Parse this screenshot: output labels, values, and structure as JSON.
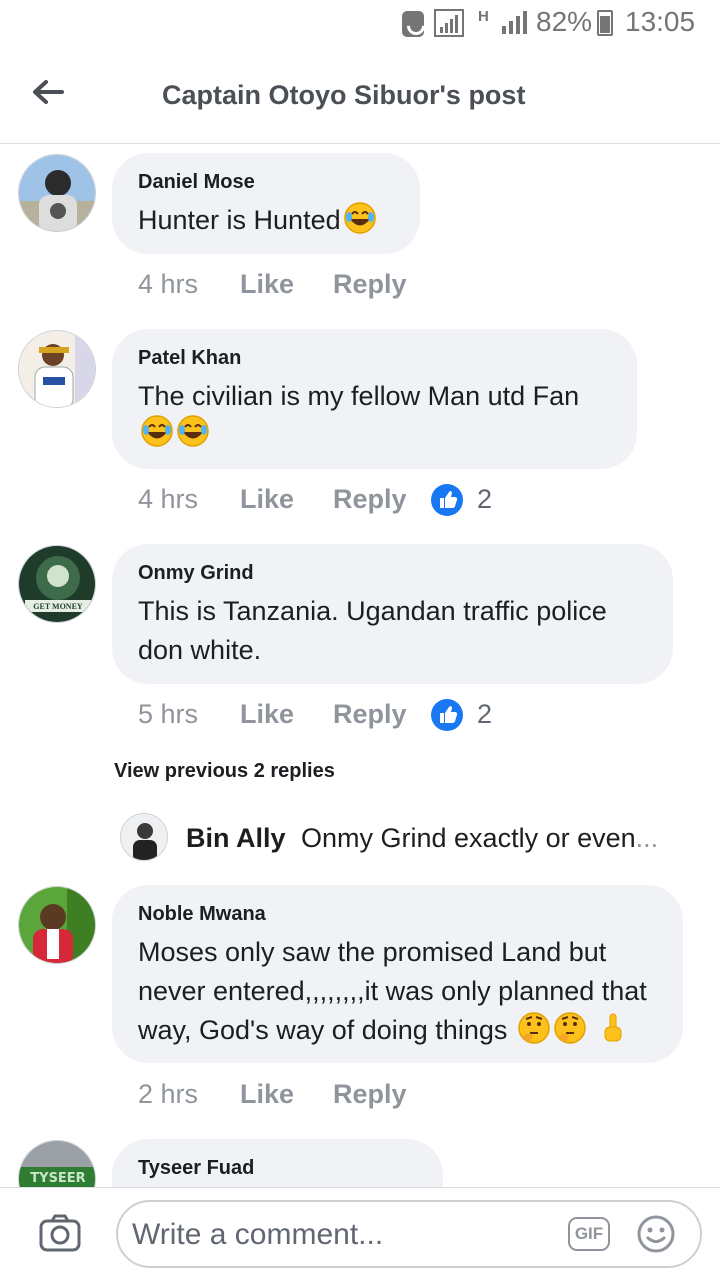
{
  "status_bar": {
    "signal_label": "H",
    "battery": "82%",
    "time": "13:05",
    "icons": [
      "phone-icon",
      "signal-icon",
      "battery-icon"
    ]
  },
  "header": {
    "title": "Captain Otoyo Sibuor's post",
    "back_icon": "arrow-left-icon"
  },
  "comments": [
    {
      "name": "Daniel Mose",
      "text": "Hunter is Hunted",
      "emoji": [
        "tears-of-joy-emoji"
      ],
      "time": "4 hrs",
      "like_label": "Like",
      "reply_label": "Reply"
    },
    {
      "name": "Patel Khan",
      "text_line1": "The civilian is my fellow Man utd Fan",
      "emoji": [
        "tears-of-joy-emoji",
        "tears-of-joy-emoji"
      ],
      "time": "4 hrs",
      "like_label": "Like",
      "reply_label": "Reply",
      "reactions": "2"
    },
    {
      "name": "Onmy Grind",
      "text_line1": "This is Tanzania. Ugandan traffic police",
      "text_line2": "don white.",
      "time": "5 hrs",
      "like_label": "Like",
      "reply_label": "Reply",
      "reactions": "2"
    },
    {
      "name": "Noble Mwana",
      "text_line1": "Moses only saw the  promised Land but",
      "text_line2": "never entered,,,,,,,,it was only planned that",
      "text_line3": "way, God's way of doing things",
      "emoji": [
        "thinking-emoji",
        "thinking-emoji",
        "pointing-up-emoji"
      ],
      "time": "2 hrs",
      "like_label": "Like",
      "reply_label": "Reply"
    },
    {
      "name": "Tyseer Fuad"
    }
  ],
  "replies": {
    "view_previous": "View previous 2 replies",
    "preview": {
      "name": "Bin Ally",
      "text": "Onmy Grind exactly or even",
      "ellipsis": "..."
    }
  },
  "composer": {
    "placeholder": "Write a comment...",
    "gif_label": "GIF",
    "icons": [
      "camera-icon",
      "gif-icon",
      "smiley-icon"
    ]
  },
  "colors": {
    "bubble": "#f0f2f5",
    "meta_text": "#90949c",
    "like_blue": "#1877f2"
  }
}
